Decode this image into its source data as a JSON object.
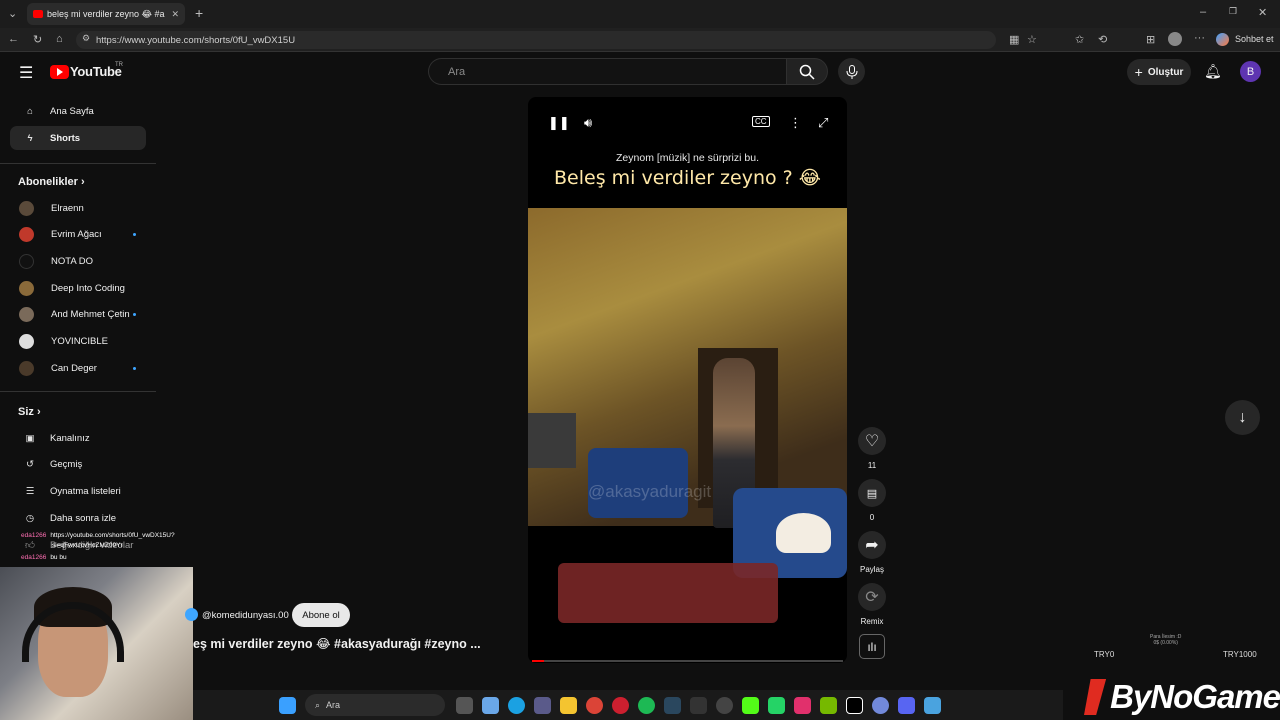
{
  "browser": {
    "tab_title": "beleş mi verdiler zeyno 😂 #a",
    "url": "https://www.youtube.com/shorts/0fU_vwDX15U",
    "copilot_label": "Sohbet et"
  },
  "header": {
    "logo": "YouTube",
    "region": "TR",
    "search_placeholder": "Ara",
    "create_label": "Oluştur",
    "avatar_letter": "B"
  },
  "sidebar": {
    "main": [
      {
        "label": "Ana Sayfa",
        "icon": "home-icon"
      },
      {
        "label": "Shorts",
        "icon": "shorts-icon"
      }
    ],
    "subs_heading": "Abonelikler",
    "subscriptions": [
      {
        "label": "Elraenn",
        "color": "#5a4a3a",
        "new": false
      },
      {
        "label": "Evrim Ağacı",
        "color": "#c0392b",
        "new": true
      },
      {
        "label": "NOTA DO",
        "color": "#111111",
        "new": false
      },
      {
        "label": "Deep Into Coding",
        "color": "#8a6a3a",
        "new": false
      },
      {
        "label": "And Mehmet Çetin",
        "color": "#7a6a5a",
        "new": true
      },
      {
        "label": "YOVINCIBLE",
        "color": "#dddddd",
        "new": false
      },
      {
        "label": "Can Deger",
        "color": "#4a3a2a",
        "new": true
      }
    ],
    "you_heading": "Siz",
    "you_items": [
      {
        "label": "Kanalınız",
        "icon": "channel-icon"
      },
      {
        "label": "Geçmiş",
        "icon": "history-icon"
      },
      {
        "label": "Oynatma listeleri",
        "icon": "playlist-icon"
      },
      {
        "label": "Daha sonra izle",
        "icon": "clock-icon"
      },
      {
        "label": "Beğendiğin videolar",
        "icon": "like-icon"
      }
    ]
  },
  "player": {
    "caption_small": "Zeynom [müzik] ne sürprizi bu.",
    "caption_big": "Beleş mi verdiler zeyno ? 😂",
    "watermark": "@akasyaduragit",
    "progress": 0.04
  },
  "actions": {
    "likes": "11",
    "comments": "0",
    "share": "Paylaş",
    "remix": "Remix"
  },
  "short_info": {
    "channel": "@komedidunyası.00",
    "subscribe": "Abone ol",
    "title": "eş mi verdiler zeyno 😂 #akasyadurağı #zeyno ..."
  },
  "chat": [
    {
      "user": "eda1266",
      "msg": "https://youtube.com/shorts/0fU_vwDX15U?"
    },
    {
      "user": "",
      "msg": "si=qFwxUcvHoZMZ09Yr"
    },
    {
      "user": "eda1266",
      "msg": "bu bu"
    }
  ],
  "taskbar": {
    "search": "Ara"
  },
  "overlay": {
    "brand": "ByNoGame",
    "ticker_left": "TRY0",
    "ticker_right": "TRY1000",
    "ticker_small_1": "Para İlesim :D",
    "ticker_small_2": "0$ (0.00%)"
  }
}
